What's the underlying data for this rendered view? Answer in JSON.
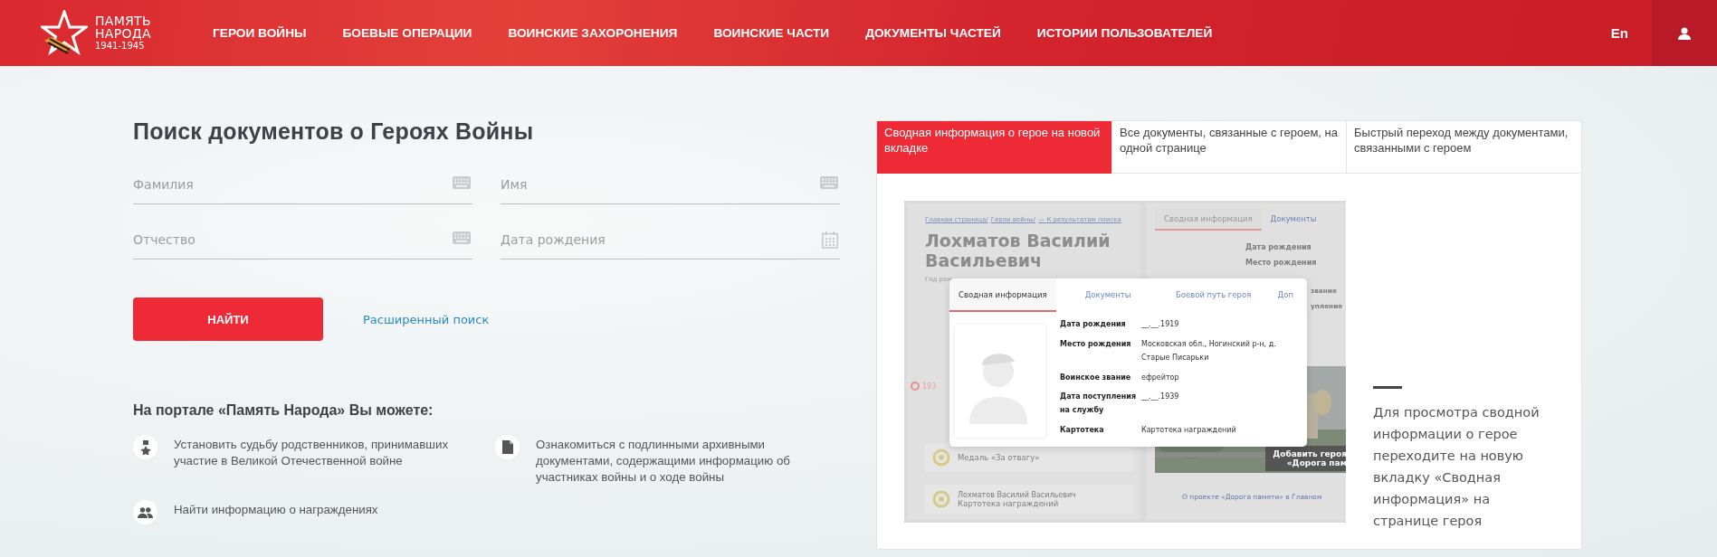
{
  "header": {
    "logo": {
      "lines": [
        "ПАМЯТЬ",
        "НАРОДА"
      ],
      "years": "1941-1945"
    },
    "nav": [
      "ГЕРОИ ВОЙНЫ",
      "БОЕВЫЕ ОПЕРАЦИИ",
      "ВОИНСКИЕ ЗАХОРОНЕНИЯ",
      "ВОИНСКИЕ ЧАСТИ",
      "ДОКУМЕНТЫ ЧАСТЕЙ",
      "ИСТОРИИ ПОЛЬЗОВАТЕЛЕЙ"
    ],
    "language": "En"
  },
  "search": {
    "title": "Поиск документов о Героях Войны",
    "fields": [
      {
        "placeholder": "Фамилия",
        "kind": "keyboard"
      },
      {
        "placeholder": "Имя",
        "kind": "keyboard"
      },
      {
        "placeholder": "Отчество",
        "kind": "keyboard"
      },
      {
        "placeholder": "Дата рождения",
        "kind": "calendar"
      }
    ],
    "submit": "НАЙТИ",
    "advanced_link": "Расширенный поиск"
  },
  "features": {
    "title": "На портале «Память Народа» Вы можете:",
    "items": [
      {
        "kind": "medal",
        "text": "Установить судьбу родственников, принимавших участие в Великой Отечественной войне"
      },
      {
        "kind": "document",
        "text": "Ознакомиться с подлинными архивными документами, содержащими информацию об участниках войны и о ходе войны"
      },
      {
        "kind": "people",
        "text": "Найти информацию о награждениях"
      }
    ]
  },
  "showcase": {
    "tabs": [
      {
        "label": "Сводная информация о герое на новой вкладке",
        "selected": true
      },
      {
        "label": "Все документы, связанные с героем, на одной странице",
        "selected": false
      },
      {
        "label": "Быстрый переход между документами, связанными с героем",
        "selected": false
      }
    ],
    "preview": {
      "breadcrumbs": [
        "Главная страница/",
        "Герои войны/",
        "— К результатам поиска"
      ],
      "hero_name": "Лохматов Василий Васильевич",
      "birth_year_label": "Год рож",
      "timeline_year": "193",
      "cards": [
        {
          "subtitle": "Медаль «За отвагу»"
        },
        {
          "title": "Лохматов Василий Васильевич",
          "subtitle": "Картотека награждений"
        }
      ],
      "tabs": [
        {
          "label": "Сводная информация",
          "selected": true
        },
        {
          "label": "Документы",
          "selected": false
        }
      ],
      "labels": [
        "Дата рождения",
        "Место рождения",
        "звание",
        "упления"
      ],
      "banner": [
        "Добавить героя",
        "«Дорога пам"
      ],
      "project_link": "О проекте «Дорога памяти» в Главном",
      "popup": {
        "tabs": [
          {
            "label": "Сводная информация",
            "selected": true
          },
          {
            "label": "Документы",
            "selected": false
          },
          {
            "label": "Боевой путь героя",
            "selected": false
          },
          {
            "label": "Доп",
            "selected": false
          }
        ],
        "fields": [
          {
            "label": "Дата рождения",
            "value": "__.__.1919"
          },
          {
            "label": "Место рождения",
            "value": "Московская обл., Ногинский р-н, д. Старые Писарьки"
          },
          {
            "label": "Воинское звание",
            "value": "ефрейтор"
          },
          {
            "label": "Дата поступления на службу",
            "value": "__.__.1939"
          },
          {
            "label": "Картотека",
            "value": "Картотека награждений"
          }
        ]
      }
    },
    "note": "Для просмотра сводной информации о герое переходите на новую вкладку «Сводная информация» на странице героя"
  }
}
